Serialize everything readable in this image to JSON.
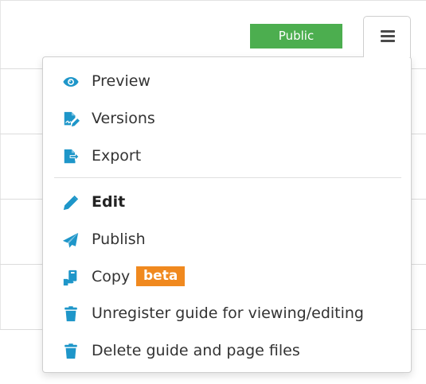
{
  "header": {
    "status_badge": "Public",
    "menu_toggle_icon": "hamburger-icon"
  },
  "colors": {
    "accent_icon": "#1e96c9",
    "status_public": "#4cae4f",
    "beta_badge": "#f0891f",
    "text": "#333333"
  },
  "menu": {
    "groups": [
      {
        "items": [
          {
            "label": "Preview",
            "icon": "eye-icon"
          },
          {
            "label": "Versions",
            "icon": "file-signature-icon"
          },
          {
            "label": "Export",
            "icon": "file-export-icon"
          }
        ]
      },
      {
        "items": [
          {
            "label": "Edit",
            "icon": "pencil-icon",
            "bold": true
          },
          {
            "label": "Publish",
            "icon": "paper-plane-icon"
          },
          {
            "label": "Copy",
            "icon": "copy-hand-icon",
            "badge": "beta"
          },
          {
            "label": "Unregister guide for viewing/editing",
            "icon": "trash-icon"
          },
          {
            "label": "Delete guide and page files",
            "icon": "trash-icon"
          }
        ]
      }
    ]
  }
}
